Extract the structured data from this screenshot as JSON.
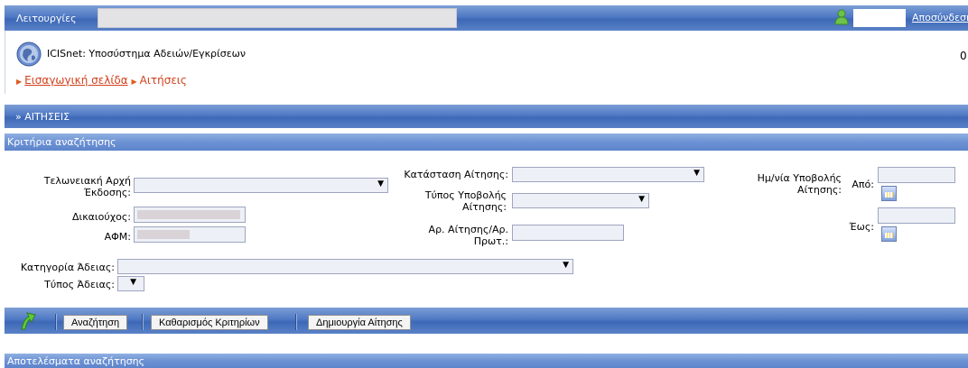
{
  "topbar": {
    "menu_label": "Λειτουργίες",
    "logout_label": "Αποσύνδεση"
  },
  "header": {
    "app_title": "ICISnet: Υποσύστημα Αδειών/Εγκρίσεων",
    "counter": "0",
    "breadcrumb": {
      "home_label": "Εισαγωγική σελίδα",
      "current_label": "Αιτήσεις"
    }
  },
  "section": {
    "title": "» ΑΙΤΗΣΕΙΣ"
  },
  "criteria": {
    "title": "Κριτήρια αναζήτησης",
    "customs_office_label": "Τελωνειακή Αρχή Έκδοσης:",
    "beneficiary_label": "Δικαιούχος:",
    "afm_label": "ΑΦΜ:",
    "status_label": "Κατάσταση Αίτησης:",
    "submission_type_label": "Τύπος Υποβολής Αίτησης:",
    "application_no_label": "Αρ. Αίτησης/Αρ. Πρωτ.:",
    "submission_date_label": "Ημ/νία Υποβολής Αίτησης:",
    "from_label": "Από:",
    "to_label": "Έως:",
    "license_category_label": "Κατηγορία Άδειας:",
    "license_type_label": "Τύπος Άδειας:"
  },
  "toolbar": {
    "search_label": "Αναζήτηση",
    "clear_label": "Καθαρισμός Κριτηρίων",
    "create_label": "Δημιουργία Αίτησης"
  },
  "results": {
    "title": "Αποτελέσματα αναζήτησης"
  },
  "colors": {
    "bar_blue": "#4f79c4",
    "link_orange": "#d2401a",
    "field_bg": "#eef0f7"
  }
}
